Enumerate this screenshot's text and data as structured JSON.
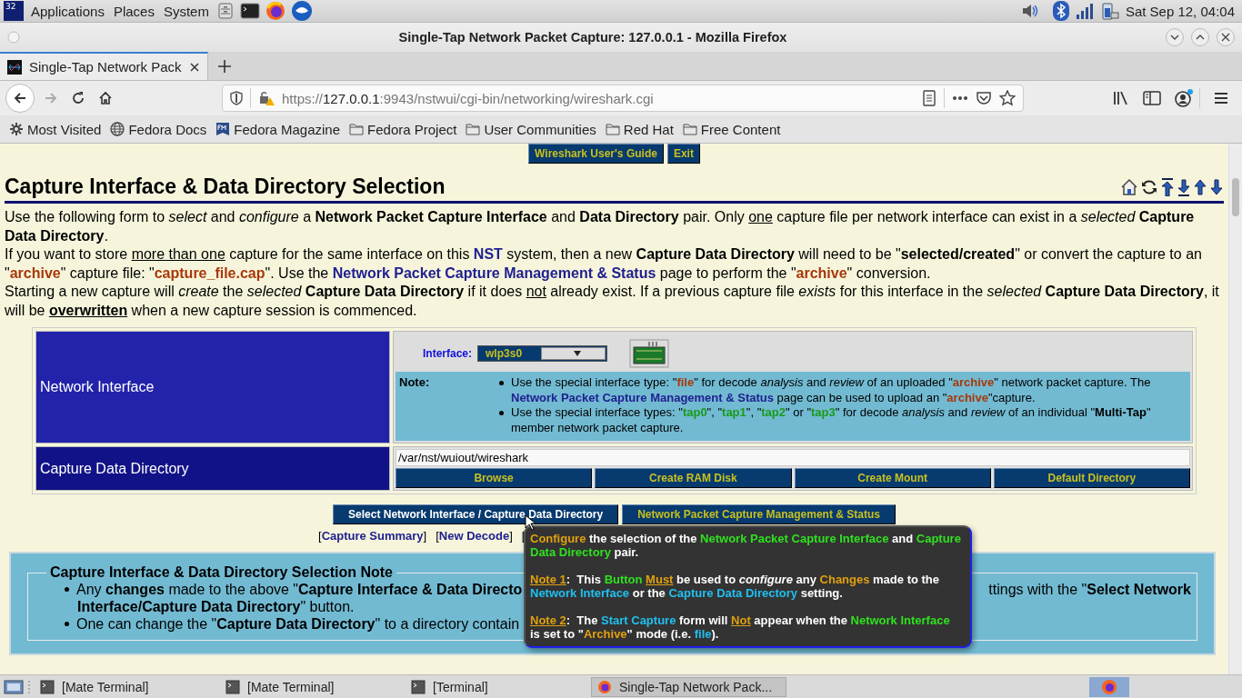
{
  "os_panel": {
    "logo": "32",
    "menus": [
      "Applications",
      "Places",
      "System"
    ],
    "clock": "Sat Sep 12, 04:04"
  },
  "window": {
    "title": "Single-Tap Network Packet Capture: 127.0.0.1 - Mozilla Firefox"
  },
  "tabs": [
    {
      "label": "Single-Tap Network Pack",
      "selected": true
    }
  ],
  "address_bar": {
    "scheme": "https://",
    "host": "127.0.0.1",
    "path": ":9943/nstwui/cgi-bin/networking/wireshark.cgi"
  },
  "bookmarks": [
    {
      "label": "Most Visited",
      "kind": "gear"
    },
    {
      "label": "Fedora Docs",
      "kind": "globe"
    },
    {
      "label": "Fedora Magazine",
      "kind": "fm"
    },
    {
      "label": "Fedora Project",
      "kind": "folder"
    },
    {
      "label": "User Communities",
      "kind": "folder"
    },
    {
      "label": "Red Hat",
      "kind": "folder"
    },
    {
      "label": "Free Content",
      "kind": "folder"
    }
  ],
  "page": {
    "top_buttons": [
      "Wireshark User's Guide",
      "Exit"
    ],
    "heading": "Capture Interface & Data Directory Selection",
    "paragraphs": [
      [
        {
          "text": "Use the following form to ",
          "kind": "plain"
        },
        {
          "text": "select",
          "kind": "italic"
        },
        {
          "text": " and ",
          "kind": "plain"
        },
        {
          "text": "configure",
          "kind": "italic"
        },
        {
          "text": " a ",
          "kind": "plain"
        },
        {
          "text": "Network Packet Capture Interface",
          "kind": "bold"
        },
        {
          "text": " and ",
          "kind": "plain"
        },
        {
          "text": "Data Directory",
          "kind": "bold"
        },
        {
          "text": " pair. Only ",
          "kind": "plain"
        },
        {
          "text": "one",
          "kind": "underlined"
        },
        {
          "text": " capture file per network interface can exist in a ",
          "kind": "plain"
        },
        {
          "text": "selected ",
          "kind": "italic"
        },
        {
          "text": "Capture Data Directory",
          "kind": "bold"
        },
        {
          "text": ".",
          "kind": "plain"
        }
      ],
      [
        {
          "text": "If you want to store ",
          "kind": "plain"
        },
        {
          "text": "more than one",
          "kind": "underlined"
        },
        {
          "text": " capture for the same interface on this ",
          "kind": "plain"
        },
        {
          "text": "NST",
          "kind": "reference"
        },
        {
          "text": " system, then a new ",
          "kind": "plain"
        },
        {
          "text": "Capture Data Directory",
          "kind": "bold"
        },
        {
          "text": " will need to be \"",
          "kind": "plain"
        },
        {
          "text": "selected/created",
          "kind": "bold"
        },
        {
          "text": "\" or convert the capture to an \"",
          "kind": "plain"
        },
        {
          "text": "archive",
          "kind": "term"
        },
        {
          "text": "\" capture file: \"",
          "kind": "plain"
        },
        {
          "text": "capture_file.cap",
          "kind": "term"
        },
        {
          "text": "\". Use the ",
          "kind": "plain"
        },
        {
          "text": "Network Packet Capture Management & Status",
          "kind": "reference"
        },
        {
          "text": " page to perform the \"",
          "kind": "plain"
        },
        {
          "text": "archive",
          "kind": "term"
        },
        {
          "text": "\" conversion.",
          "kind": "plain"
        }
      ],
      [
        {
          "text": "Starting a new capture will ",
          "kind": "plain"
        },
        {
          "text": "create",
          "kind": "italic"
        },
        {
          "text": " the ",
          "kind": "plain"
        },
        {
          "text": "selected ",
          "kind": "italic"
        },
        {
          "text": "Capture Data Directory",
          "kind": "bold"
        },
        {
          "text": " if it does ",
          "kind": "plain"
        },
        {
          "text": "not",
          "kind": "underlined"
        },
        {
          "text": " already exist. If a previous capture file ",
          "kind": "plain"
        },
        {
          "text": "exists",
          "kind": "italic"
        },
        {
          "text": " for this interface in the ",
          "kind": "plain"
        },
        {
          "text": "selected ",
          "kind": "italic"
        },
        {
          "text": "Capture Data Directory",
          "kind": "bold"
        },
        {
          "text": ", it will be ",
          "kind": "plain"
        },
        {
          "text": "overwritten",
          "kind": "emphatic"
        },
        {
          "text": " when a new capture session is commenced.",
          "kind": "plain"
        }
      ]
    ],
    "form": {
      "interface_row": {
        "label": "Network Interface",
        "field_label": "Interface:",
        "value": "wlp3s0",
        "note_label": "Note:",
        "notes": [
          [
            {
              "text": "Use the special interface type: \"",
              "kind": "plain"
            },
            {
              "text": "file",
              "kind": "term"
            },
            {
              "text": "\" for decode ",
              "kind": "plain"
            },
            {
              "text": "analysis",
              "kind": "italic"
            },
            {
              "text": " and ",
              "kind": "plain"
            },
            {
              "text": "review",
              "kind": "italic"
            },
            {
              "text": " of an uploaded \"",
              "kind": "plain"
            },
            {
              "text": "archive",
              "kind": "term"
            },
            {
              "text": "\" network packet capture. The ",
              "kind": "plain"
            },
            {
              "text": "Network Packet Capture Management & Status",
              "kind": "reference"
            },
            {
              "text": " page can be used to upload an \"",
              "kind": "plain"
            },
            {
              "text": "archive",
              "kind": "term"
            },
            {
              "text": "\"capture.",
              "kind": "plain"
            }
          ],
          [
            {
              "text": "Use the special interface types: \"",
              "kind": "plain"
            },
            {
              "text": "tap0",
              "kind": "tap"
            },
            {
              "text": "\", \"",
              "kind": "plain"
            },
            {
              "text": "tap1",
              "kind": "tap"
            },
            {
              "text": "\", \"",
              "kind": "plain"
            },
            {
              "text": "tap2",
              "kind": "tap"
            },
            {
              "text": "\" or \"",
              "kind": "plain"
            },
            {
              "text": "tap3",
              "kind": "tap"
            },
            {
              "text": "\" for decode ",
              "kind": "plain"
            },
            {
              "text": "analysis",
              "kind": "italic"
            },
            {
              "text": " and ",
              "kind": "plain"
            },
            {
              "text": "review",
              "kind": "italic"
            },
            {
              "text": " of an individual \"",
              "kind": "plain"
            },
            {
              "text": "Multi-Tap",
              "kind": "bold"
            },
            {
              "text": "\" member network packet capture.",
              "kind": "plain"
            }
          ]
        ]
      },
      "directory_row": {
        "label": "Capture Data Directory",
        "value": "/var/nst/wuiout/wireshark",
        "buttons": [
          "Browse",
          "Create RAM Disk",
          "Create Mount",
          "Default Directory"
        ]
      }
    },
    "main_buttons": [
      {
        "label": "Select Network Interface / Capture Data Directory",
        "hovered": true
      },
      {
        "label": "Network Packet Capture Management & Status",
        "hovered": false
      }
    ],
    "links": [
      {
        "open": "[",
        "label": "Capture Summary",
        "close": "]"
      },
      {
        "open": "[",
        "label": "New Decode",
        "close": "]"
      }
    ],
    "partial_link": "[",
    "selection_note": {
      "legend": "Capture Interface & Data Directory Selection Note",
      "items": [
        {
          "left": [
            {
              "text": "Any ",
              "kind": "plain"
            },
            {
              "text": "changes",
              "kind": "bold"
            },
            {
              "text": " made to the above \"",
              "kind": "plain"
            },
            {
              "text": "Capture Interface & Data Directo",
              "kind": "bold"
            }
          ],
          "right": [
            {
              "text": "ttings with the \"",
              "kind": "plain"
            },
            {
              "text": "Select Network",
              "kind": "bold"
            }
          ],
          "continuation": [
            {
              "text": "Interface/Capture Data Directory",
              "kind": "bold"
            },
            {
              "text": "\" button.",
              "kind": "plain"
            }
          ]
        },
        {
          "left": [
            {
              "text": "One can change the \"",
              "kind": "plain"
            },
            {
              "text": "Capture Data Directory",
              "kind": "bold"
            },
            {
              "text": "\" to a directory contain",
              "kind": "plain"
            }
          ]
        }
      ]
    },
    "tooltip": [
      [
        {
          "text": "Configure",
          "kind": "highlight"
        },
        {
          "text": " the selection of the ",
          "kind": "plain"
        },
        {
          "text": "Network Packet Capture Interface",
          "kind": "name"
        },
        {
          "text": " and ",
          "kind": "plain"
        },
        {
          "text": "Capture Data Directory",
          "kind": "name"
        },
        {
          "text": " pair.",
          "kind": "plain"
        }
      ],
      [
        {
          "text": "Note 1",
          "kind": "warning"
        },
        {
          "text": ":  This ",
          "kind": "plain"
        },
        {
          "text": "Button ",
          "kind": "name"
        },
        {
          "text": "Must",
          "kind": "warning"
        },
        {
          "text": " be used to ",
          "kind": "plain"
        },
        {
          "text": "configure",
          "kind": "italic"
        },
        {
          "text": " any ",
          "kind": "plain"
        },
        {
          "text": "Changes",
          "kind": "highlight"
        },
        {
          "text": " made to the ",
          "kind": "plain"
        },
        {
          "text": "Network Interface",
          "kind": "setting"
        },
        {
          "text": " or the ",
          "kind": "plain"
        },
        {
          "text": "Capture Data Directory",
          "kind": "setting"
        },
        {
          "text": " setting.",
          "kind": "plain"
        }
      ],
      [
        {
          "text": "Note 2",
          "kind": "warning"
        },
        {
          "text": ":  The ",
          "kind": "plain"
        },
        {
          "text": "Start Capture",
          "kind": "setting"
        },
        {
          "text": " form will ",
          "kind": "plain"
        },
        {
          "text": "Not",
          "kind": "warning"
        },
        {
          "text": " appear when the ",
          "kind": "plain"
        },
        {
          "text": "Network Interface",
          "kind": "name"
        },
        {
          "text": " is set to \"",
          "kind": "plain"
        },
        {
          "text": "Archive",
          "kind": "highlight"
        },
        {
          "text": "\" mode (i.e. ",
          "kind": "plain"
        },
        {
          "text": "file",
          "kind": "setting"
        },
        {
          "text": ").",
          "kind": "plain"
        }
      ]
    ]
  },
  "taskbar": [
    {
      "label": "[Mate Terminal]",
      "kind": "terminal",
      "selected": false
    },
    {
      "label": "[Mate Terminal]",
      "kind": "terminal",
      "selected": false
    },
    {
      "label": "[Terminal]",
      "kind": "terminal",
      "selected": false
    },
    {
      "label": "Single-Tap Network Pack...",
      "kind": "browser",
      "selected": true
    }
  ]
}
